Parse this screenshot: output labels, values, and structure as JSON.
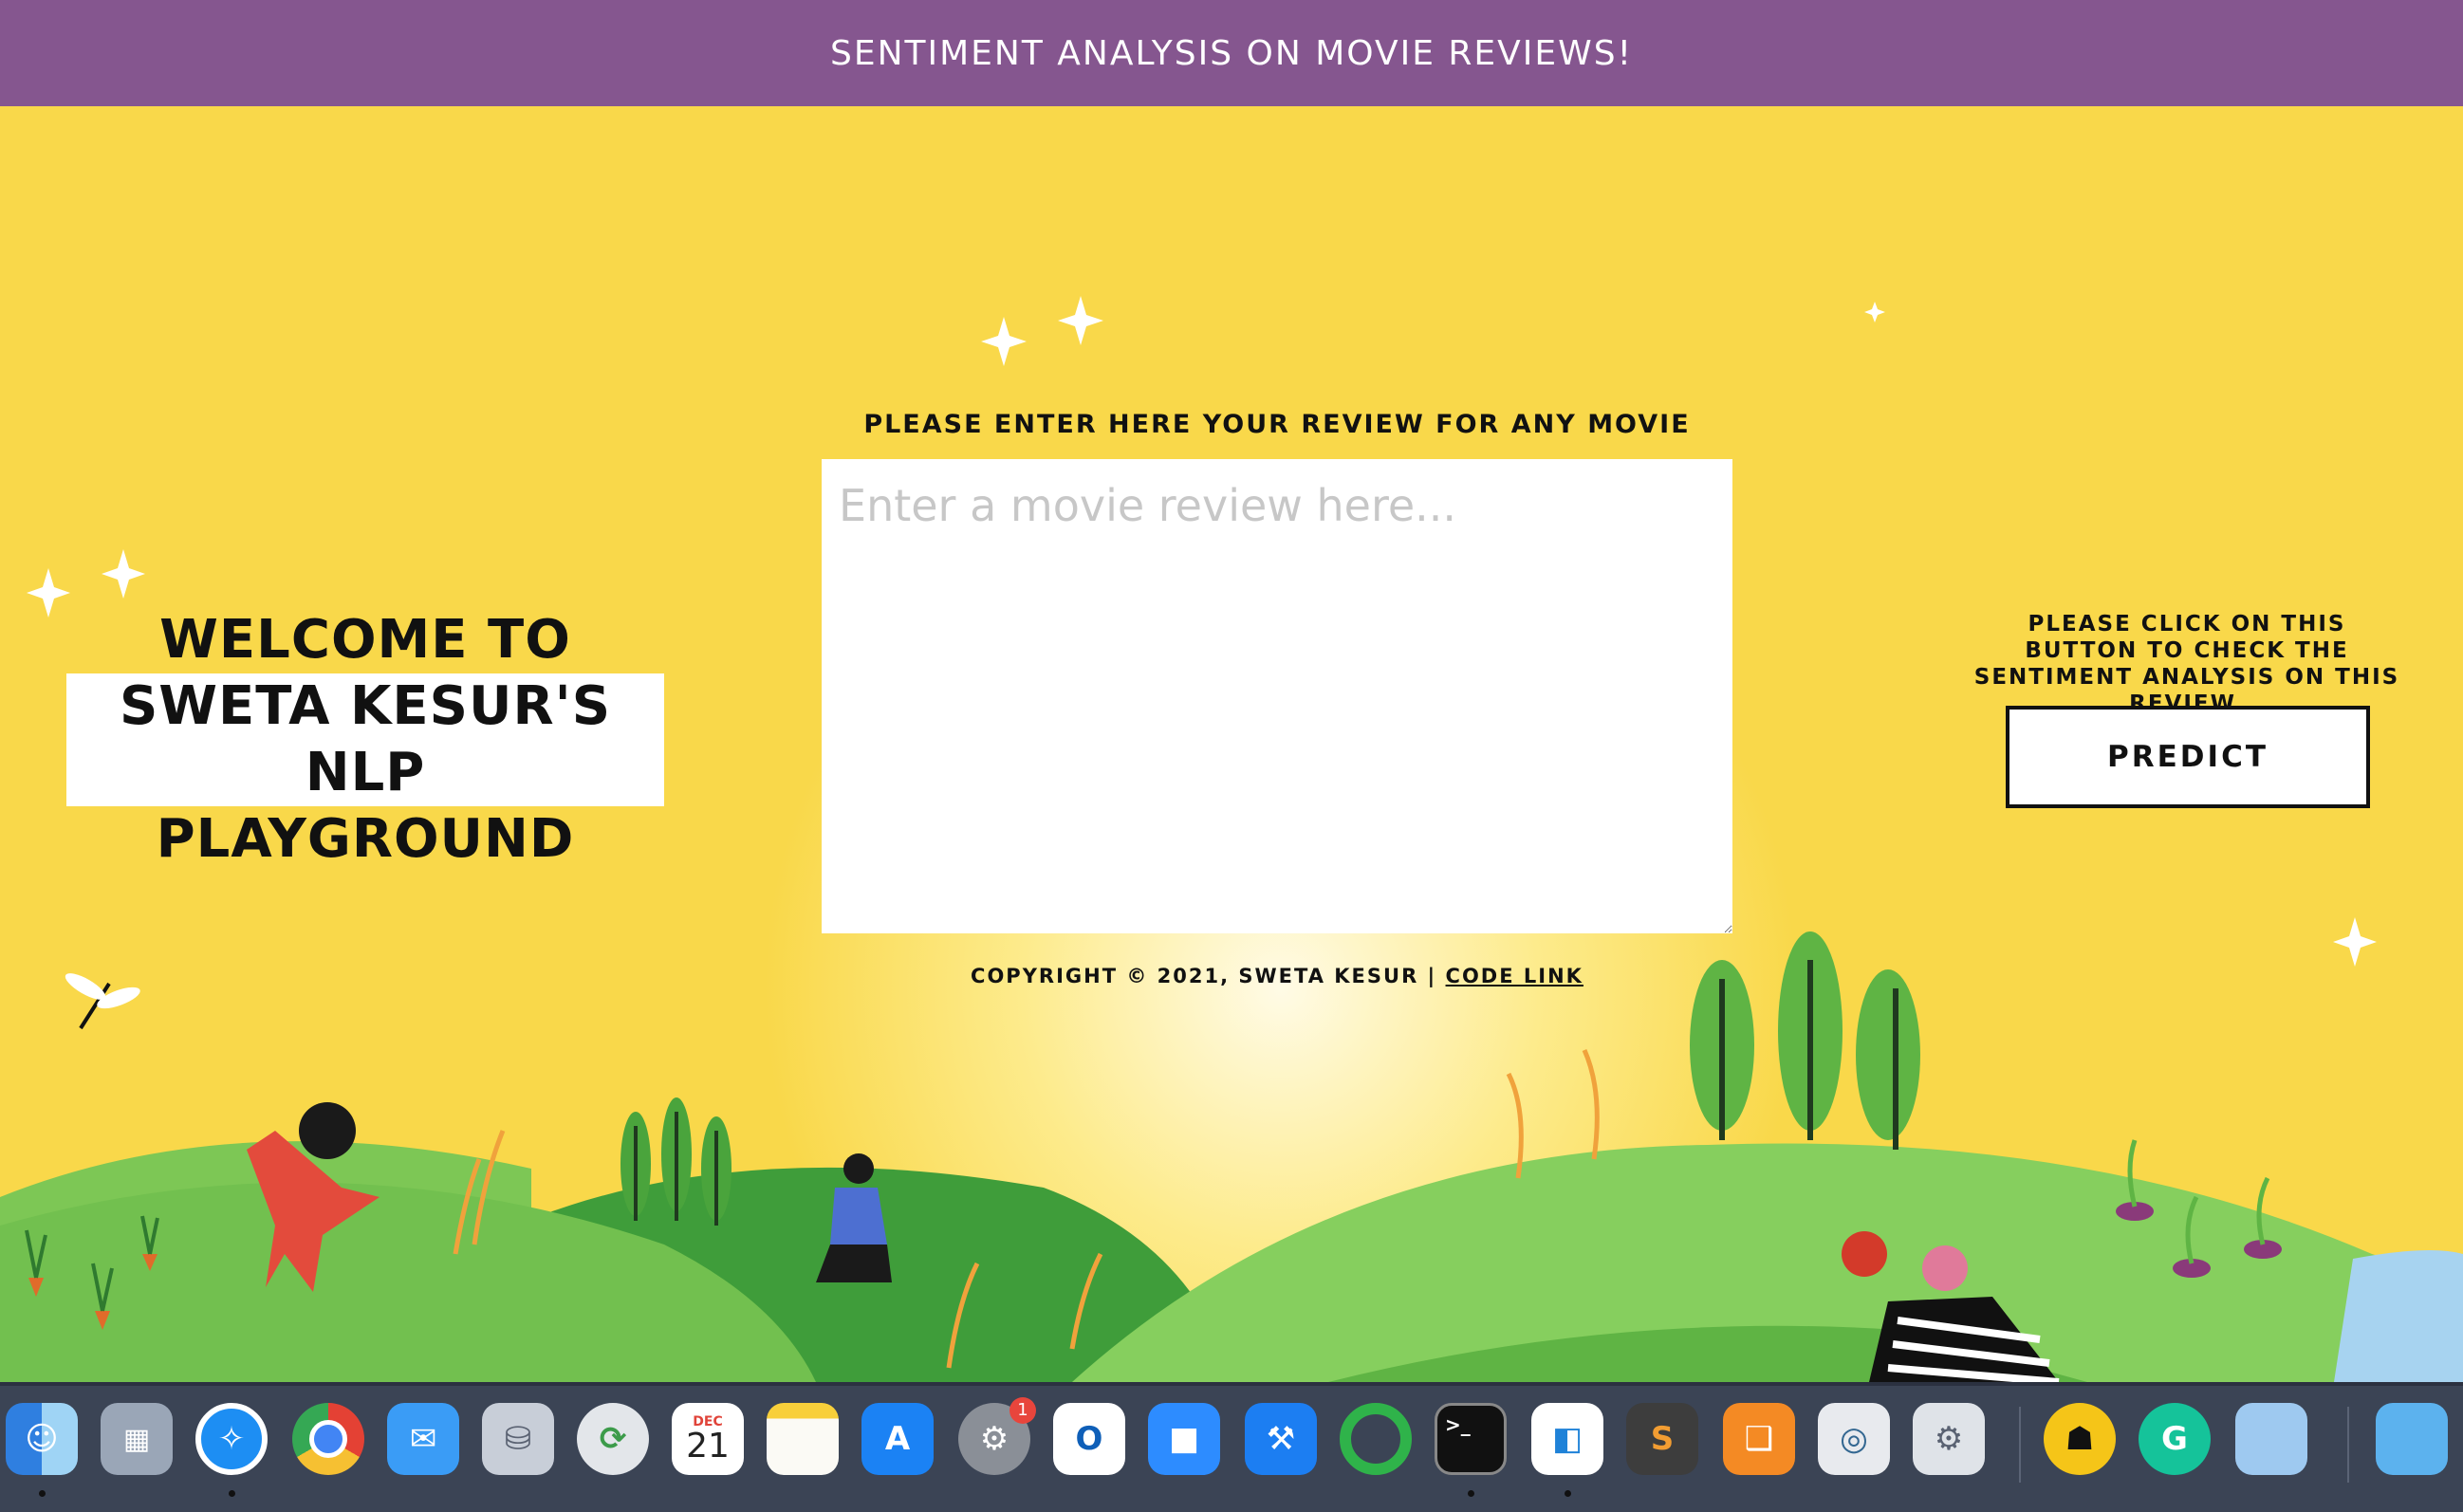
{
  "header": {
    "title": "SENTIMENT ANALYSIS ON MOVIE REVIEWS!"
  },
  "welcome": {
    "line1": "WELCOME TO",
    "line2": "SWETA KESUR'S NLP",
    "line3": "PLAYGROUND"
  },
  "review": {
    "label": "PLEASE ENTER HERE YOUR REVIEW FOR ANY MOVIE",
    "placeholder": "Enter a movie review here...",
    "value": ""
  },
  "predict": {
    "instruction": "PLEASE CLICK ON THIS BUTTON TO CHECK THE SENTIMENT ANALYSIS ON THIS REVIEW.",
    "button_label": "PREDICT"
  },
  "footer": {
    "copyright": "COPYRIGHT © 2021, SWETA KESUR |",
    "code_link": "CODE LINK"
  },
  "dock": {
    "calendar_month": "DEC",
    "calendar_day": "21",
    "settings_badge": "1",
    "terminal_prompt": ">_"
  },
  "colors": {
    "header_bg": "#85568f",
    "page_bg": "#f9d84a",
    "hill_light": "#7dc755",
    "hill_dark": "#3f9d3a"
  }
}
